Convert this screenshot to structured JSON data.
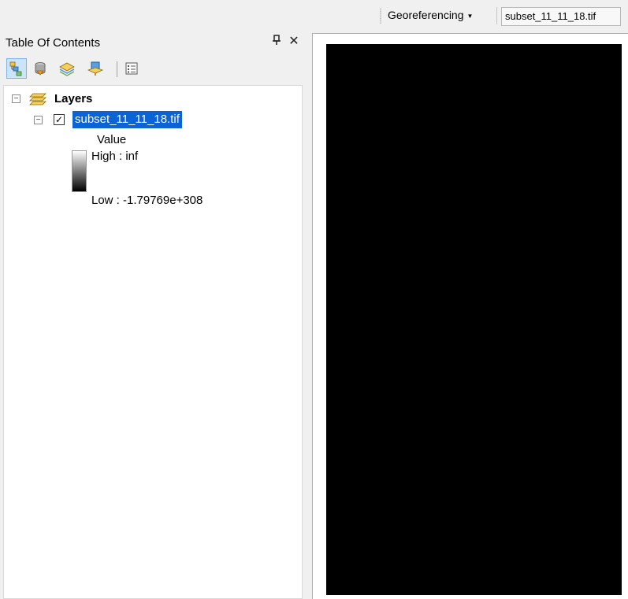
{
  "toolbar": {
    "georeferencing_label": "Georeferencing",
    "layer_combo_value": "subset_11_11_18.tif"
  },
  "toc": {
    "title": "Table Of Contents",
    "pin_glyph": "ф",
    "close_glyph": "✕",
    "tools": [
      {
        "name": "list-by-drawing-order-icon",
        "active": true
      },
      {
        "name": "list-by-source-icon",
        "active": false
      },
      {
        "name": "list-by-visibility-icon",
        "active": false
      },
      {
        "name": "list-by-selection-icon",
        "active": false
      },
      {
        "name": "options-icon",
        "active": false
      }
    ],
    "layers_group": {
      "label": "Layers",
      "expanded": true
    },
    "layer": {
      "name": "subset_11_11_18.tif",
      "checked": true,
      "legend": {
        "field": "Value",
        "high": "High : inf",
        "low": "Low : -1.79769e+308"
      }
    }
  },
  "map": {
    "raster_color": "#000000"
  },
  "colors": {
    "selection": "#0a64d6",
    "background": "#f0f0f0"
  }
}
